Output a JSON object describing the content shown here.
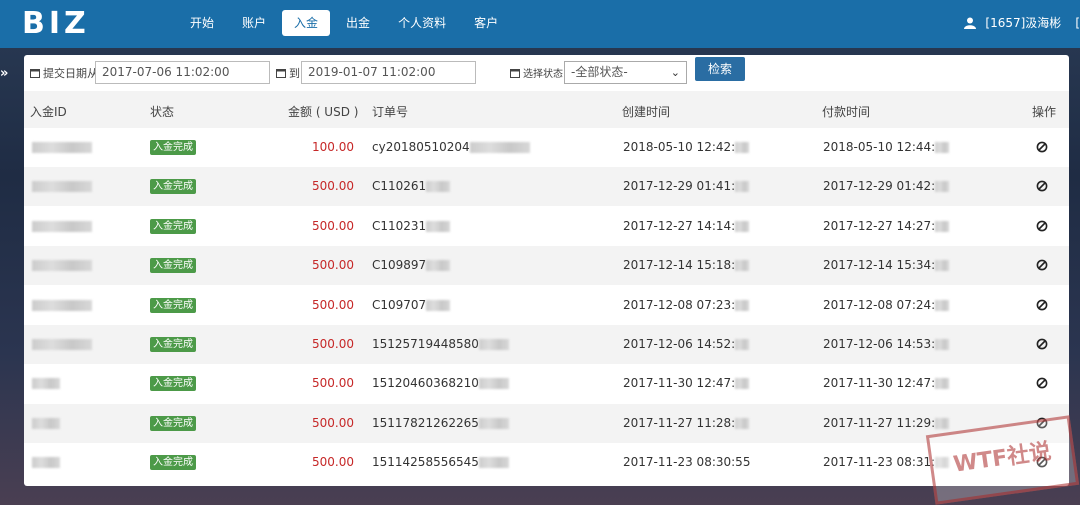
{
  "header": {
    "logo": "BIZ",
    "nav": [
      "开始",
      "账户",
      "入金",
      "出金",
      "个人资料",
      "客户"
    ],
    "active_index": 2,
    "user": "[1657]汲海彬",
    "user_sep": "[",
    "brand_color": "#1a6ea8"
  },
  "filters": {
    "date_label": "提交日期从",
    "date_from": "2017-07-06 11:02:00",
    "to_label": "到",
    "date_to": "2019-01-07 11:02:00",
    "status_label": "选择状态",
    "status_value": "-全部状态-",
    "search_label": "检索"
  },
  "table": {
    "headers": [
      "入金ID",
      "状态",
      "金额 ( USD )",
      "订单号",
      "创建时间",
      "付款时间",
      "操作"
    ],
    "rows": [
      {
        "status": "入金完成",
        "amount": "100.00",
        "order": "cy20180510204",
        "created": "2018-05-10 12:42:",
        "paid": "2018-05-10 12:44:"
      },
      {
        "status": "入金完成",
        "amount": "500.00",
        "order": "C110261",
        "created": "2017-12-29 01:41:",
        "paid": "2017-12-29 01:42:"
      },
      {
        "status": "入金完成",
        "amount": "500.00",
        "order": "C110231",
        "created": "2017-12-27 14:14:",
        "paid": "2017-12-27 14:27:"
      },
      {
        "status": "入金完成",
        "amount": "500.00",
        "order": "C109897",
        "created": "2017-12-14 15:18:",
        "paid": "2017-12-14 15:34:"
      },
      {
        "status": "入金完成",
        "amount": "500.00",
        "order": "C109707",
        "created": "2017-12-08 07:23:",
        "paid": "2017-12-08 07:24:"
      },
      {
        "status": "入金完成",
        "amount": "500.00",
        "order": "15125719448580",
        "created": "2017-12-06 14:52:",
        "paid": "2017-12-06 14:53:"
      },
      {
        "status": "入金完成",
        "amount": "500.00",
        "order": "15120460368210",
        "created": "2017-11-30 12:47:",
        "paid": "2017-11-30 12:47:"
      },
      {
        "status": "入金完成",
        "amount": "500.00",
        "order": "15117821262265",
        "created": "2017-11-27 11:28:",
        "paid": "2017-11-27 11:29:"
      },
      {
        "status": "入金完成",
        "amount": "500.00",
        "order": "15114258556545",
        "created": "2017-11-23 08:30:55",
        "paid": "2017-11-23 08:31:"
      }
    ]
  },
  "watermark": "WTF社说",
  "colors": {
    "amount": "#c62828",
    "badge": "#4c9a48",
    "search": "#2a6da3"
  }
}
